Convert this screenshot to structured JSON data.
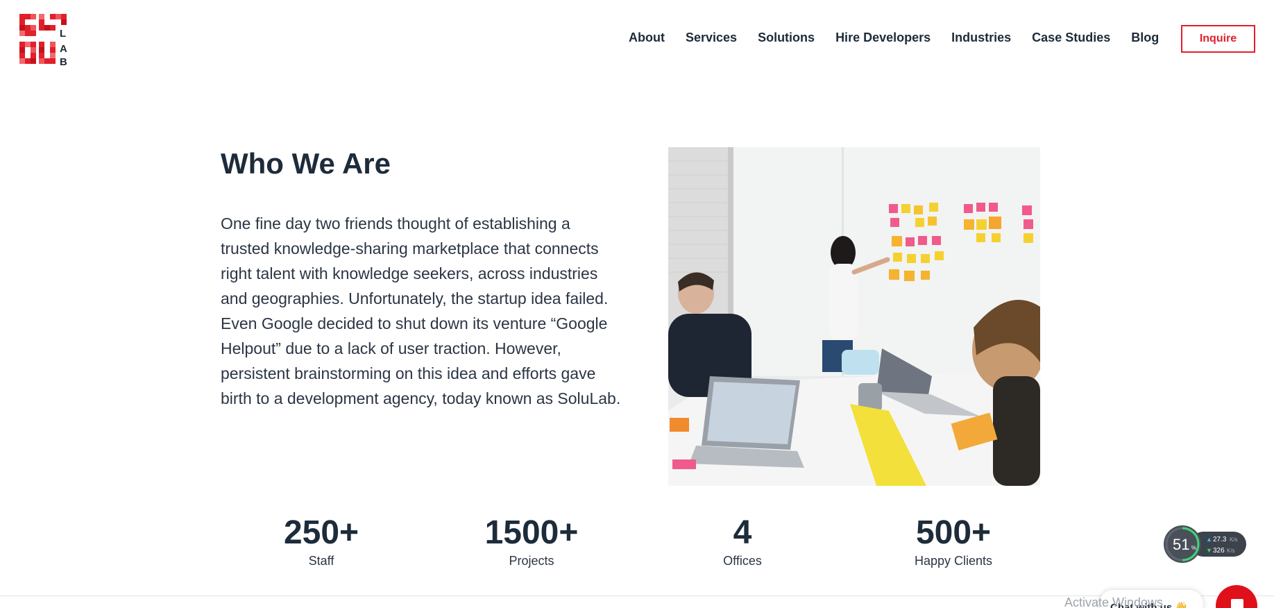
{
  "brand": {
    "logo_letters": "SOLULAB",
    "logo_side_text": [
      "L",
      "A",
      "B"
    ],
    "accent_color": "#e0202a",
    "text_color": "#1d2b3a"
  },
  "nav": {
    "items": [
      {
        "label": "About"
      },
      {
        "label": "Services"
      },
      {
        "label": "Solutions"
      },
      {
        "label": "Hire Developers"
      },
      {
        "label": "Industries"
      },
      {
        "label": "Case Studies"
      },
      {
        "label": "Blog"
      }
    ],
    "cta_label": "Inquire"
  },
  "who_we_are": {
    "title": "Who We Are",
    "paragraph": "One fine day two friends thought of establishing a trusted knowledge-sharing marketplace that connects right talent with knowledge seekers, across industries and geographies. Unfortunately, the startup idea failed. Even Google decided to shut down its venture “Google Helpout” due to a lack of user traction. However, persistent brainstorming on this idea and efforts gave birth to a development agency, today known as SoluLab.",
    "photo_alt": "team-meeting-photo"
  },
  "stats": [
    {
      "value": "250+",
      "label": "Staff"
    },
    {
      "value": "1500+",
      "label": "Projects"
    },
    {
      "value": "4",
      "label": "Offices"
    },
    {
      "value": "500+",
      "label": "Happy Clients"
    }
  ],
  "net_widget": {
    "percent": "51",
    "percent_unit": "%",
    "up": "27.3",
    "up_unit": "K/s",
    "down": "326",
    "down_unit": "K/s"
  },
  "chat": {
    "pill_label": "Chat with us",
    "emoji": "👋"
  },
  "os_watermark": "Activate Windows"
}
